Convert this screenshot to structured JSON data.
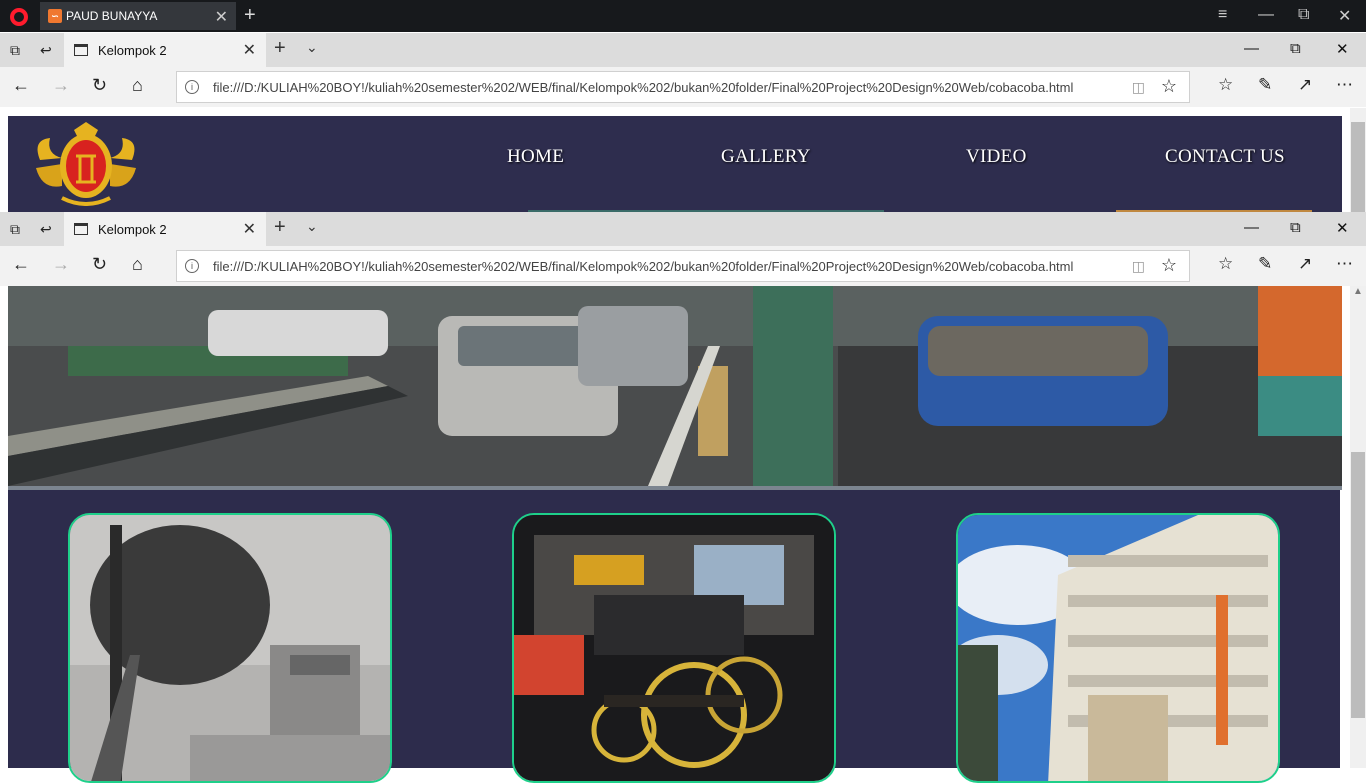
{
  "opera": {
    "tab_title": "PAUD BUNAYYA",
    "xampp_icon": "xampp-icon",
    "controls": [
      "menu-icon",
      "minimize-icon",
      "restore-icon",
      "close-icon"
    ]
  },
  "edge": {
    "tab_title": "Kelompok 2",
    "url": "file:///D:/KULIAH%20BOY!/kuliah%20semester%202/WEB/final/Kelompok%202/bukan%20folder/Final%20Project%20Design%20Web/cobacoba.html",
    "toolbar_icons": [
      "favorites-icon",
      "pen-icon",
      "share-icon",
      "more-icon"
    ]
  },
  "site": {
    "nav": [
      "HOME",
      "GALLERY",
      "VIDEO",
      "CONTACT US"
    ],
    "logo": "royal-crest-logo",
    "hero": "street-scene-image",
    "gallery": [
      "historic-street-photo",
      "andong-carriage-photo",
      "hotel-mutiara-photo"
    ]
  },
  "colors": {
    "header_bg": "#2e2d4e",
    "card_border": "#1ed08a",
    "opera_red": "#ff1b2d"
  }
}
